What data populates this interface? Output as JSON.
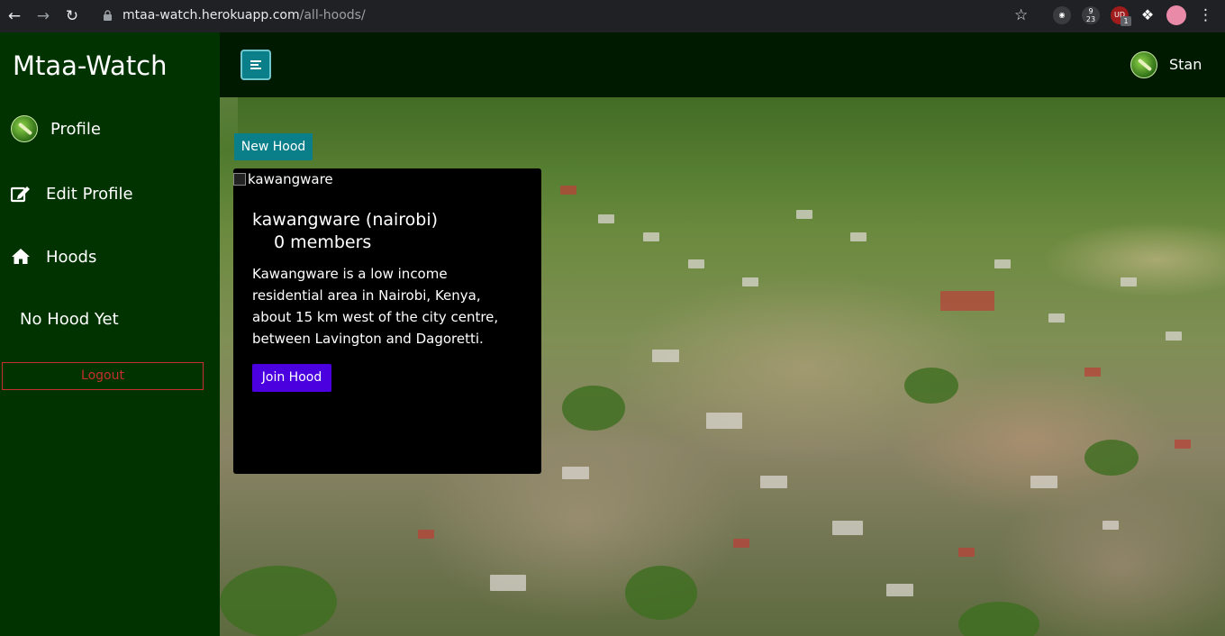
{
  "browser": {
    "url_host": "mtaa-watch.herokuapp.com",
    "url_path": "/all-hoods/",
    "ext_badge_1": "9",
    "ext_badge_1b": "23",
    "ext_badge_2": "1"
  },
  "sidebar": {
    "brand": "Mtaa-Watch",
    "items": [
      {
        "label": "Profile",
        "icon": "avatar"
      },
      {
        "label": "Edit Profile",
        "icon": "edit-icon"
      },
      {
        "label": "Hoods",
        "icon": "home-icon"
      },
      {
        "label": "No Hood Yet",
        "icon": ""
      }
    ],
    "logout_label": "Logout"
  },
  "header": {
    "user_name": "Stan"
  },
  "main": {
    "new_hood_label": "New Hood",
    "hood": {
      "image_alt": "kawangware",
      "title": "kawangware (nairobi)",
      "members": "0 members",
      "description": "Kawangware is a low income residential area in Nairobi, Kenya, about 15 km west of the city centre, between Lavington and Dagoretti.",
      "join_label": "Join Hood"
    }
  },
  "colors": {
    "sidebar_bg": "#003300",
    "topbar_bg": "#001a00",
    "teal": "#0a7f8a",
    "join": "#4b00e0",
    "logout": "#c4302b"
  }
}
